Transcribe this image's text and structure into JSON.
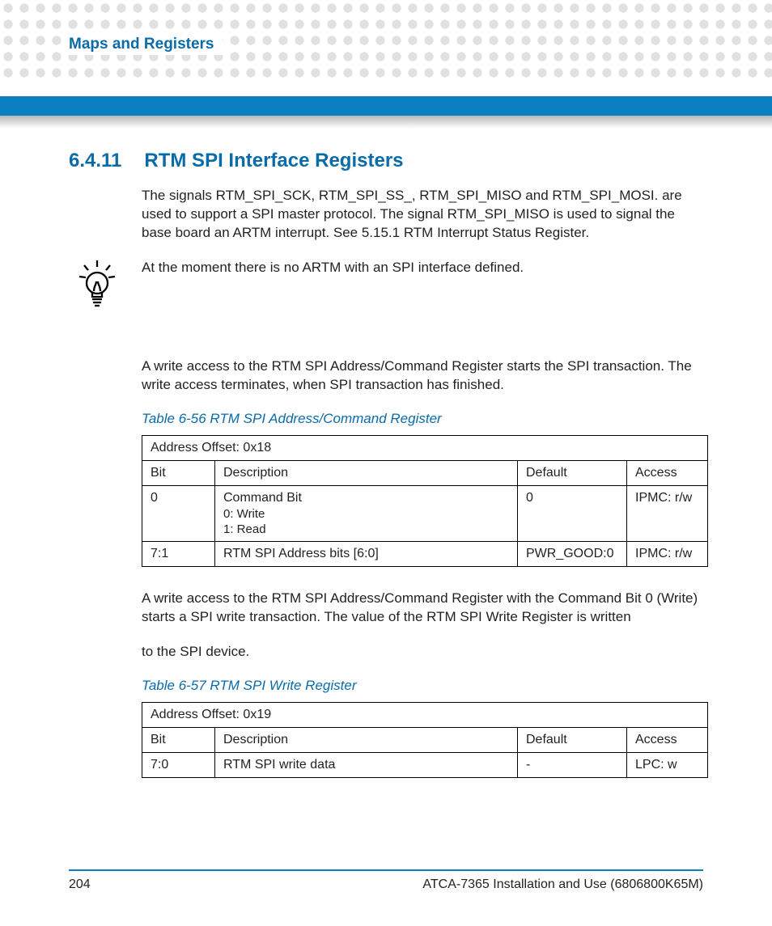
{
  "header": {
    "chapter": "Maps and Registers"
  },
  "section": {
    "number": "6.4.11",
    "title": "RTM SPI Interface Registers"
  },
  "para1": "The signals RTM_SPI_SCK, RTM_SPI_SS_, RTM_SPI_MISO and RTM_SPI_MOSI. are used to support a SPI master protocol. The signal RTM_SPI_MISO is used to signal the base board an ARTM interrupt. See 5.15.1 RTM Interrupt Status Register.",
  "note": "At the moment there is no ARTM with an SPI interface defined.",
  "para2": "A write access to the RTM SPI Address/Command Register starts the SPI transaction. The write access terminates, when SPI transaction has finished.",
  "table1": {
    "caption": "Table 6-56 RTM SPI Address/Command Register",
    "address": "Address Offset: 0x18",
    "headers": {
      "c1": "Bit",
      "c2": "Description",
      "c3": "Default",
      "c4": "Access"
    },
    "rows": [
      {
        "bit": "0",
        "desc": "Command Bit",
        "sub1": "0: Write",
        "sub2": "1: Read",
        "def": "0",
        "acc": "IPMC: r/w"
      },
      {
        "bit": "7:1",
        "desc": "RTM SPI Address bits [6:0]",
        "def": "PWR_GOOD:0",
        "acc": "IPMC: r/w"
      }
    ]
  },
  "para3": "A write access to the RTM SPI Address/Command Register with the Command Bit 0 (Write) starts a SPI write transaction. The value of the RTM SPI Write Register is written",
  "para4": "to the SPI device.",
  "table2": {
    "caption": "Table 6-57 RTM SPI Write Register",
    "address": "Address Offset: 0x19",
    "headers": {
      "c1": "Bit",
      "c2": "Description",
      "c3": "Default",
      "c4": "Access"
    },
    "rows": [
      {
        "bit": "7:0",
        "desc": "RTM SPI write data",
        "def": "-",
        "acc": "LPC: w"
      }
    ]
  },
  "footer": {
    "page": "204",
    "doc": "ATCA-7365 Installation and Use (6806800K65M)"
  }
}
